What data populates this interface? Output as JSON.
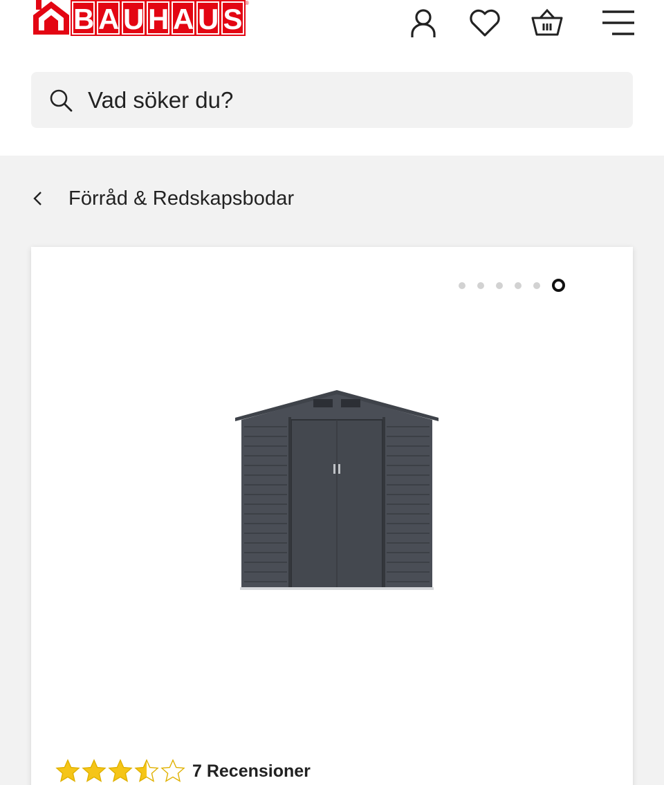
{
  "brand": {
    "logo_text": "BAUHAUS",
    "letters": [
      "B",
      "A",
      "U",
      "H",
      "A",
      "U",
      "S"
    ],
    "color": "#e30613",
    "registered_mark": "®"
  },
  "header_icons": [
    "user-icon",
    "heart-icon",
    "basket-icon",
    "menu-icon"
  ],
  "search": {
    "placeholder": "Vad söker du?"
  },
  "breadcrumb": {
    "label": "Förråd & Redskapsbodar"
  },
  "carousel": {
    "total_slides": 6,
    "active_index": 5
  },
  "product": {
    "image": "dark grey metal garden shed"
  },
  "rating": {
    "stars": 3.5,
    "max_stars": 5,
    "review_count_label": "7 Recensioner"
  },
  "colors": {
    "accent": "#e30613",
    "star": "#f5c518",
    "page_bg": "#f2f2f2"
  }
}
